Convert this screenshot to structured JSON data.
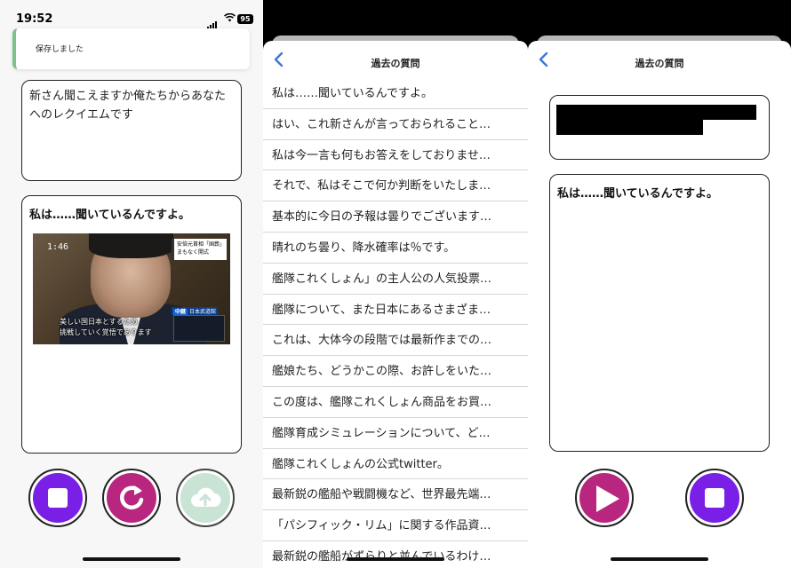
{
  "status_bar": {
    "time": "19:52",
    "battery": "95"
  },
  "screen1": {
    "toast": "保存しました",
    "input_text": "新さん聞こえますか俺たちからあなたへのレクイエムです",
    "answer_text": "私は……聞いているんですよ。",
    "thumbnail": {
      "clock": "1:46",
      "tag_line1": "安倍元首相「国葬」",
      "tag_line2": "まもなく開式",
      "caption_line1": "美しい国日本とするため",
      "caption_line2": "挑戦していく覚悟であります",
      "live_badge": "中継",
      "live_place": "日本武道館"
    },
    "buttons": {
      "stop": {
        "icon": "stop-icon",
        "color": "#7a1fe6"
      },
      "redo": {
        "icon": "redo-icon",
        "color": "#b8267f"
      },
      "upload": {
        "icon": "cloud-upload-icon",
        "color": "#c9e3d4",
        "disabled": true
      }
    }
  },
  "screen2": {
    "title": "過去の質問",
    "items": [
      "私は……聞いているんですよ。",
      "はい、これ新さんが言っておられること…",
      "私は今一言も何もお答えをしておりませ…",
      "それで、私はそこで何か判断をいたしま…",
      "基本的に今日の予報は曇りでございます…",
      "晴れのち曇り、降水確率は％です。",
      "艦隊これくしょん」の主人公の人気投票…",
      "艦隊について、また日本にあるさまざま…",
      "これは、大体今の段階では最新作までの…",
      "艦娘たち、どうかこの際、お許しをいた…",
      "この度は、艦隊これくしょん商品をお買…",
      "艦隊育成シミュレーションについて、ど…",
      "艦隊これくしょんの公式twitter。",
      "最新鋭の艦船や戦闘機など、世界最先端…",
      "「パシフィック・リム」に関する作品資…",
      "最新鋭の艦船がずらりと並んでいるわけ…"
    ]
  },
  "screen3": {
    "title": "過去の質問",
    "answer_text": "私は……聞いているんですよ。",
    "buttons": {
      "play": {
        "icon": "play-icon",
        "color": "#b8267f"
      },
      "stop": {
        "icon": "stop-icon",
        "color": "#7a1fe6"
      }
    }
  },
  "colors": {
    "accent_back": "#3a78d8",
    "toast_border": "#7fc18a"
  }
}
